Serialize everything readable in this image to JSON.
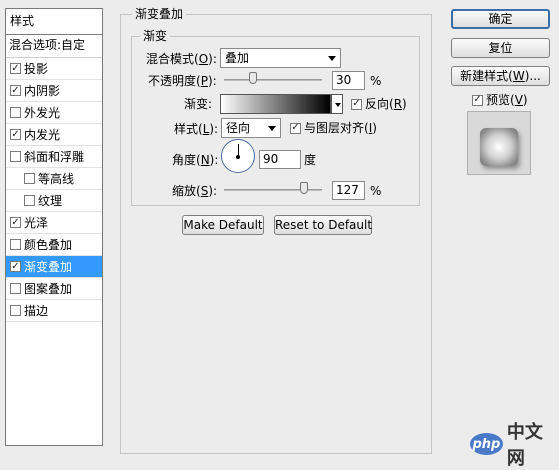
{
  "styles_panel": {
    "title": "样式",
    "blend_options": "混合选项:自定",
    "items": [
      {
        "label": "投影",
        "checked": true
      },
      {
        "label": "内阴影",
        "checked": true
      },
      {
        "label": "外发光",
        "checked": false
      },
      {
        "label": "内发光",
        "checked": true
      },
      {
        "label": "斜面和浮雕",
        "checked": false
      },
      {
        "label": "等高线",
        "checked": false
      },
      {
        "label": "纹理",
        "checked": false
      },
      {
        "label": "光泽",
        "checked": true
      },
      {
        "label": "颜色叠加",
        "checked": false
      },
      {
        "label": "渐变叠加",
        "checked": true
      },
      {
        "label": "图案叠加",
        "checked": false
      },
      {
        "label": "描边",
        "checked": false
      }
    ],
    "check_mark": "✓"
  },
  "gradient_overlay": {
    "group_title": "渐变叠加",
    "sub_group_title": "渐变",
    "blend_mode": {
      "label": "混合模式(",
      "key": "O",
      "suffix": "):",
      "value": "叠加"
    },
    "opacity": {
      "label": "不透明度(",
      "key": "P",
      "suffix": "):",
      "value": "30",
      "unit": "%",
      "level": 0.3
    },
    "gradient": {
      "label": "渐变:",
      "colors": [
        "#ffffff",
        "#000000"
      ]
    },
    "reverse": {
      "label_prefix": "反向(",
      "key": "R",
      "label_suffix": ")",
      "checked": true
    },
    "style": {
      "label": "样式(",
      "key": "L",
      "suffix": "):",
      "value": "径向"
    },
    "align_with_layer": {
      "label_prefix": "与图层对齐(",
      "key": "I",
      "label_suffix": ")",
      "checked": true
    },
    "angle": {
      "label": "角度(",
      "key": "N",
      "suffix": "):",
      "value": "90",
      "unit": "度"
    },
    "scale": {
      "label": "缩放(",
      "key": "S",
      "suffix": "):",
      "value": "127",
      "unit": "%",
      "level": 0.85
    },
    "make_default": "Make Default",
    "reset_default": "Reset to Default"
  },
  "actions": {
    "ok": "确定",
    "reset": "复位",
    "new_style_prefix": "新建样式(",
    "new_style_key": "W",
    "new_style_suffix": ")...",
    "preview": {
      "label_prefix": "预览(",
      "key": "V",
      "label_suffix": ")",
      "checked": true
    }
  },
  "watermark": {
    "logo": "php",
    "text": "中文网"
  }
}
